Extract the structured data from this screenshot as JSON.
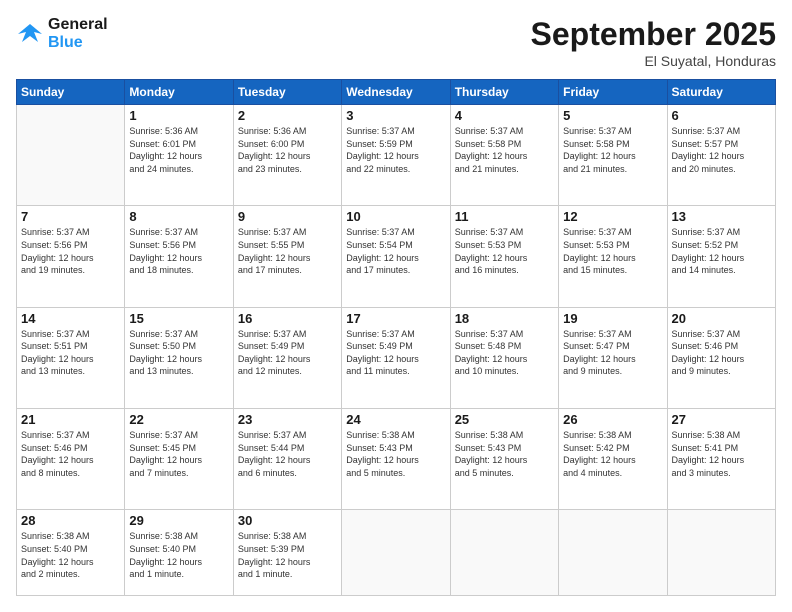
{
  "header": {
    "logo_line1": "General",
    "logo_line2": "Blue",
    "month": "September 2025",
    "location": "El Suyatal, Honduras"
  },
  "days_of_week": [
    "Sunday",
    "Monday",
    "Tuesday",
    "Wednesday",
    "Thursday",
    "Friday",
    "Saturday"
  ],
  "weeks": [
    [
      {
        "day": "",
        "info": ""
      },
      {
        "day": "1",
        "info": "Sunrise: 5:36 AM\nSunset: 6:01 PM\nDaylight: 12 hours\nand 24 minutes."
      },
      {
        "day": "2",
        "info": "Sunrise: 5:36 AM\nSunset: 6:00 PM\nDaylight: 12 hours\nand 23 minutes."
      },
      {
        "day": "3",
        "info": "Sunrise: 5:37 AM\nSunset: 5:59 PM\nDaylight: 12 hours\nand 22 minutes."
      },
      {
        "day": "4",
        "info": "Sunrise: 5:37 AM\nSunset: 5:58 PM\nDaylight: 12 hours\nand 21 minutes."
      },
      {
        "day": "5",
        "info": "Sunrise: 5:37 AM\nSunset: 5:58 PM\nDaylight: 12 hours\nand 21 minutes."
      },
      {
        "day": "6",
        "info": "Sunrise: 5:37 AM\nSunset: 5:57 PM\nDaylight: 12 hours\nand 20 minutes."
      }
    ],
    [
      {
        "day": "7",
        "info": "Sunrise: 5:37 AM\nSunset: 5:56 PM\nDaylight: 12 hours\nand 19 minutes."
      },
      {
        "day": "8",
        "info": "Sunrise: 5:37 AM\nSunset: 5:56 PM\nDaylight: 12 hours\nand 18 minutes."
      },
      {
        "day": "9",
        "info": "Sunrise: 5:37 AM\nSunset: 5:55 PM\nDaylight: 12 hours\nand 17 minutes."
      },
      {
        "day": "10",
        "info": "Sunrise: 5:37 AM\nSunset: 5:54 PM\nDaylight: 12 hours\nand 17 minutes."
      },
      {
        "day": "11",
        "info": "Sunrise: 5:37 AM\nSunset: 5:53 PM\nDaylight: 12 hours\nand 16 minutes."
      },
      {
        "day": "12",
        "info": "Sunrise: 5:37 AM\nSunset: 5:53 PM\nDaylight: 12 hours\nand 15 minutes."
      },
      {
        "day": "13",
        "info": "Sunrise: 5:37 AM\nSunset: 5:52 PM\nDaylight: 12 hours\nand 14 minutes."
      }
    ],
    [
      {
        "day": "14",
        "info": "Sunrise: 5:37 AM\nSunset: 5:51 PM\nDaylight: 12 hours\nand 13 minutes."
      },
      {
        "day": "15",
        "info": "Sunrise: 5:37 AM\nSunset: 5:50 PM\nDaylight: 12 hours\nand 13 minutes."
      },
      {
        "day": "16",
        "info": "Sunrise: 5:37 AM\nSunset: 5:49 PM\nDaylight: 12 hours\nand 12 minutes."
      },
      {
        "day": "17",
        "info": "Sunrise: 5:37 AM\nSunset: 5:49 PM\nDaylight: 12 hours\nand 11 minutes."
      },
      {
        "day": "18",
        "info": "Sunrise: 5:37 AM\nSunset: 5:48 PM\nDaylight: 12 hours\nand 10 minutes."
      },
      {
        "day": "19",
        "info": "Sunrise: 5:37 AM\nSunset: 5:47 PM\nDaylight: 12 hours\nand 9 minutes."
      },
      {
        "day": "20",
        "info": "Sunrise: 5:37 AM\nSunset: 5:46 PM\nDaylight: 12 hours\nand 9 minutes."
      }
    ],
    [
      {
        "day": "21",
        "info": "Sunrise: 5:37 AM\nSunset: 5:46 PM\nDaylight: 12 hours\nand 8 minutes."
      },
      {
        "day": "22",
        "info": "Sunrise: 5:37 AM\nSunset: 5:45 PM\nDaylight: 12 hours\nand 7 minutes."
      },
      {
        "day": "23",
        "info": "Sunrise: 5:37 AM\nSunset: 5:44 PM\nDaylight: 12 hours\nand 6 minutes."
      },
      {
        "day": "24",
        "info": "Sunrise: 5:38 AM\nSunset: 5:43 PM\nDaylight: 12 hours\nand 5 minutes."
      },
      {
        "day": "25",
        "info": "Sunrise: 5:38 AM\nSunset: 5:43 PM\nDaylight: 12 hours\nand 5 minutes."
      },
      {
        "day": "26",
        "info": "Sunrise: 5:38 AM\nSunset: 5:42 PM\nDaylight: 12 hours\nand 4 minutes."
      },
      {
        "day": "27",
        "info": "Sunrise: 5:38 AM\nSunset: 5:41 PM\nDaylight: 12 hours\nand 3 minutes."
      }
    ],
    [
      {
        "day": "28",
        "info": "Sunrise: 5:38 AM\nSunset: 5:40 PM\nDaylight: 12 hours\nand 2 minutes."
      },
      {
        "day": "29",
        "info": "Sunrise: 5:38 AM\nSunset: 5:40 PM\nDaylight: 12 hours\nand 1 minute."
      },
      {
        "day": "30",
        "info": "Sunrise: 5:38 AM\nSunset: 5:39 PM\nDaylight: 12 hours\nand 1 minute."
      },
      {
        "day": "",
        "info": ""
      },
      {
        "day": "",
        "info": ""
      },
      {
        "day": "",
        "info": ""
      },
      {
        "day": "",
        "info": ""
      }
    ]
  ]
}
